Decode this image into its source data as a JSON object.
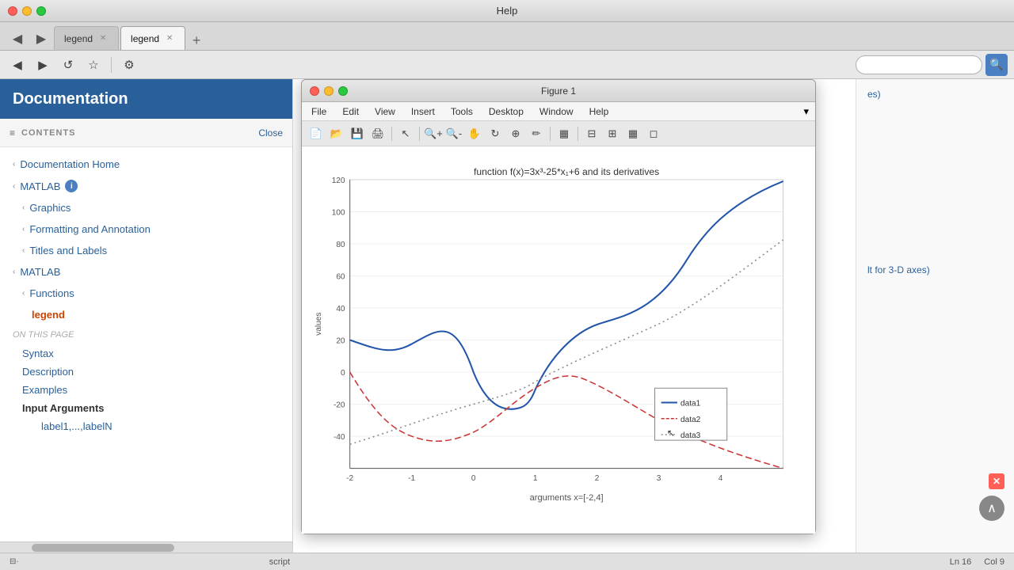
{
  "window": {
    "title": "Help"
  },
  "tabs": [
    {
      "label": "legend",
      "active": false,
      "closable": true
    },
    {
      "label": "legend",
      "active": true,
      "closable": true
    }
  ],
  "toolbar": {
    "back_label": "◀",
    "forward_label": "▶",
    "refresh_label": "↺",
    "bookmark_label": "★",
    "settings_label": "⚙",
    "search_placeholder": ""
  },
  "sidebar": {
    "title": "Documentation",
    "contents_label": "CONTENTS",
    "close_label": "Close",
    "nav_items": [
      {
        "label": "Documentation Home",
        "indent": 0,
        "chevron": true
      },
      {
        "label": "MATLAB",
        "indent": 0,
        "chevron": true,
        "info": true
      },
      {
        "label": "Graphics",
        "indent": 1,
        "chevron": true
      },
      {
        "label": "Formatting and Annotation",
        "indent": 1,
        "chevron": true
      },
      {
        "label": "Titles and Labels",
        "indent": 1,
        "chevron": true
      },
      {
        "label": "MATLAB",
        "indent": 0,
        "chevron": true
      },
      {
        "label": "Functions",
        "indent": 1,
        "chevron": true
      }
    ],
    "active_item": "legend",
    "on_this_page_label": "ON THIS PAGE",
    "sub_items": [
      {
        "label": "Syntax",
        "bold": false
      },
      {
        "label": "Description",
        "bold": false
      },
      {
        "label": "Examples",
        "bold": false
      },
      {
        "label": "Input Arguments",
        "bold": true
      },
      {
        "label": "label1,...,labelN",
        "indent": true
      }
    ]
  },
  "figure": {
    "title": "Figure 1",
    "menu_items": [
      "File",
      "Edit",
      "View",
      "Insert",
      "Tools",
      "Desktop",
      "Window",
      "Help"
    ],
    "chart_title": "function f(x)=3x³-25*x₁+6 and its derivatives",
    "x_label": "arguments x=[-2,4]",
    "y_label": "values",
    "y_axis": [
      120,
      100,
      80,
      60,
      40,
      20,
      0,
      -20,
      -40
    ],
    "x_axis": [
      -2,
      -1,
      0,
      1,
      2,
      3,
      4
    ],
    "legend": {
      "items": [
        "data1",
        "data2",
        "data3"
      ]
    }
  },
  "status_bar": {
    "left_label": "script",
    "ln_label": "Ln",
    "ln_value": "16",
    "col_label": "Col",
    "col_value": "9"
  },
  "right_panel": {
    "items": [
      {
        "label": "es)"
      },
      {
        "label": "lt for 3-D axes)"
      }
    ]
  }
}
